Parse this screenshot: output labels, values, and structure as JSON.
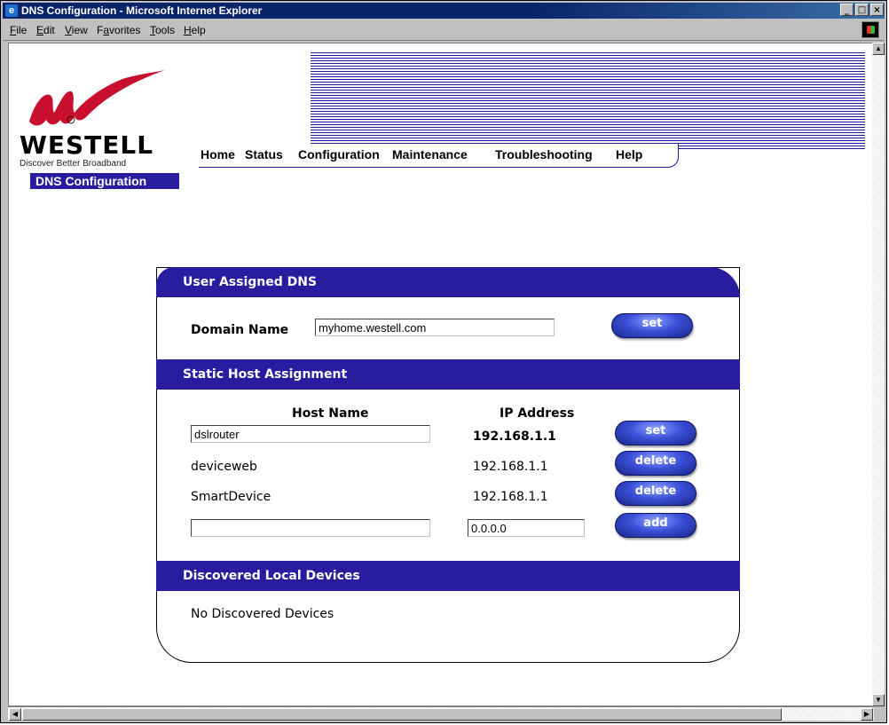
{
  "window": {
    "title": "DNS Configuration - Microsoft Internet Explorer",
    "controls": [
      "_",
      "□",
      "×"
    ]
  },
  "menu": {
    "items": [
      {
        "label": "File",
        "accel": "F",
        "rest": "ile"
      },
      {
        "label": "Edit",
        "accel": "E",
        "rest": "dit"
      },
      {
        "label": "View",
        "accel": "V",
        "rest": "iew"
      },
      {
        "label": "Favorites",
        "pre": "F",
        "accel": "a",
        "rest": "vorites"
      },
      {
        "label": "Tools",
        "accel": "T",
        "rest": "ools"
      },
      {
        "label": "Help",
        "accel": "H",
        "rest": "elp"
      }
    ]
  },
  "brand": {
    "name": "WESTELL",
    "tagline": "Discover  Better  Broadband",
    "registered": "®"
  },
  "nav": {
    "home": "Home",
    "status": "Status",
    "configuration": "Configuration",
    "maintenance": "Maintenance",
    "troubleshooting": "Troubleshooting",
    "help": "Help"
  },
  "page_label": "DNS Configuration",
  "user_dns": {
    "title": "User Assigned DNS",
    "domain_label": "Domain Name",
    "domain_value": "myhome.westell.com",
    "set_label": "set"
  },
  "static_hosts": {
    "title": "Static Host Assignment",
    "col_host": "Host Name",
    "col_ip": "IP Address",
    "rows": [
      {
        "host": "dslrouter",
        "ip": "192.168.1.1",
        "action": "set"
      },
      {
        "host": "deviceweb",
        "ip": "192.168.1.1",
        "action": "delete"
      },
      {
        "host": "SmartDevice",
        "ip": "192.168.1.1",
        "action": "delete"
      }
    ],
    "new_host_value": "",
    "new_ip_value": "0.0.0.0",
    "add_label": "add"
  },
  "discovered": {
    "title": "Discovered Local Devices",
    "empty_text": "No Discovered Devices"
  },
  "colors": {
    "brand_blue": "#2a1c9e",
    "title_bar": "#0a246a",
    "logo_red": "#c8102e"
  }
}
